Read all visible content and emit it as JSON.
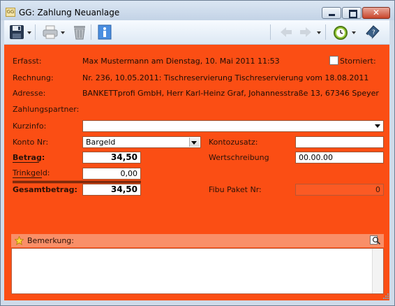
{
  "window": {
    "app_icon_text": "GG",
    "title": "GG: Zahlung Neuanlage",
    "close_glyph": "✕"
  },
  "toolbar": {
    "icons": [
      "save-icon",
      "print-icon",
      "trash-icon",
      "info-icon",
      "back-arrow-icon",
      "forward-arrow-icon",
      "clock-icon",
      "help-book-icon"
    ]
  },
  "form": {
    "erfasst_label": "Erfasst:",
    "erfasst_value": "Max Mustermann am Dienstag, 10. Mai 2011 11:53",
    "storniert_label": "Storniert:",
    "storniert_checked": false,
    "rechnung_label": "Rechnung:",
    "rechnung_value": "Nr. 236, 10.05.2011: Tischreservierung Tischreservierung vom 18.08.2011",
    "adresse_label": "Adresse:",
    "adresse_value": "BANKETTprofi GmbH, Herr Karl-Heinz Graf, Johannesstraße 13, 67346 Speyer",
    "zahlungspartner_label": "Zahlungspartner:",
    "kurzinfo_label": "Kurzinfo:",
    "kurzinfo_value": "",
    "konto_label": "Konto Nr:",
    "konto_value": "Bargeld",
    "kontozusatz_label": "Kontozusatz:",
    "kontozusatz_value": "",
    "betrag_label": "Betrag:",
    "betrag_value": "34,50",
    "wertschreibung_label": "Wertschreibung",
    "wertschreibung_value": "00.00.00",
    "trinkgeld_label": "Trinkgeld:",
    "trinkgeld_value": "0,00",
    "gesamtbetrag_label": "Gesamtbetrag:",
    "gesamtbetrag_value": "34,50",
    "fibu_label": "Fibu Paket Nr:",
    "fibu_value": "0"
  },
  "remark": {
    "label": "Bemerkung:",
    "value": ""
  },
  "colors": {
    "panel": "#fb4e14",
    "remark_header": "#f98f68"
  }
}
